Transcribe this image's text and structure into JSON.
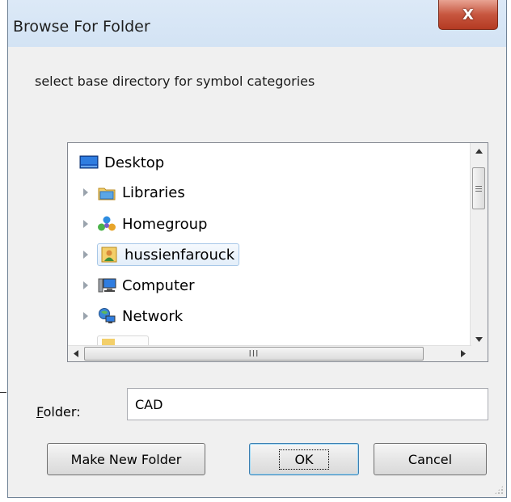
{
  "window": {
    "title": "Browse For Folder",
    "close_label": "X"
  },
  "description": "select base directory for symbol categories",
  "tree": {
    "items": [
      {
        "label": "Desktop",
        "icon": "desktop-icon",
        "expandable": false
      },
      {
        "label": "Libraries",
        "icon": "libraries-icon",
        "expandable": true
      },
      {
        "label": "Homegroup",
        "icon": "homegroup-icon",
        "expandable": true
      },
      {
        "label": "hussienfarouck",
        "icon": "user-folder-icon",
        "expandable": true,
        "selected": true
      },
      {
        "label": "Computer",
        "icon": "computer-icon",
        "expandable": true
      },
      {
        "label": "Network",
        "icon": "network-icon",
        "expandable": true
      }
    ],
    "hscroll_grip": "III"
  },
  "folder": {
    "label": "Folder:",
    "value": "CAD"
  },
  "buttons": {
    "make_new_folder": "Make New Folder",
    "ok": "OK",
    "cancel": "Cancel"
  },
  "colors": {
    "titlebar": "#d3e3f4",
    "close_button": "#c7563f",
    "dialog_bg": "#f0f0f0",
    "selection_border": "#a8c8e8"
  }
}
